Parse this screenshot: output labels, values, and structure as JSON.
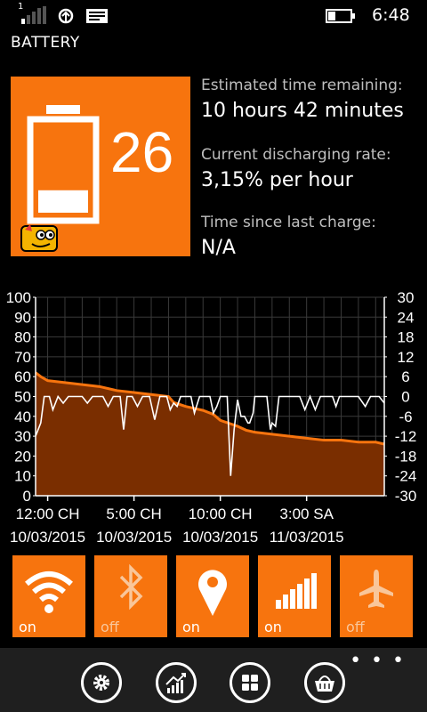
{
  "status_bar": {
    "time": "6:48",
    "sim": "1",
    "icons": [
      "signal-icon",
      "sync-icon",
      "message-icon",
      "battery-status-icon"
    ]
  },
  "app": {
    "title": "BATTERY"
  },
  "battery": {
    "percent": "26",
    "level": 0.26,
    "accent": "#f7740e",
    "info": [
      {
        "label": "Estimated time remaining:",
        "value": "10 hours 42 minutes"
      },
      {
        "label": "Current discharging rate:",
        "value": "3,15% per hour"
      },
      {
        "label": "Time since last charge:",
        "value": "N/A"
      }
    ]
  },
  "chart_data": {
    "type": "area",
    "left_ticks": [
      100,
      90,
      80,
      70,
      60,
      50,
      40,
      30,
      20,
      10,
      0
    ],
    "right_ticks": [
      30,
      24,
      18,
      12,
      6,
      0,
      -6,
      -12,
      -18,
      -24,
      -30
    ],
    "ylim_left": [
      0,
      100
    ],
    "ylim_right": [
      -30,
      30
    ],
    "x_ticks": [
      {
        "x": 0,
        "time": "12:00 CH",
        "date": "10/03/2015"
      },
      {
        "x": 5,
        "time": "5:00 CH",
        "date": "10/03/2015"
      },
      {
        "x": 10,
        "time": "10:00 CH",
        "date": "10/03/2015"
      },
      {
        "x": 15,
        "time": "3:00 SA",
        "date": "11/03/2015"
      }
    ],
    "xlim": [
      -0.7,
      19.5
    ],
    "grid": true,
    "series": [
      {
        "kind": "area",
        "axis": "left",
        "color": "#f7740e",
        "points": [
          [
            -0.7,
            62
          ],
          [
            -0.4,
            60
          ],
          [
            0,
            58
          ],
          [
            1,
            57
          ],
          [
            2,
            56
          ],
          [
            3,
            55
          ],
          [
            4,
            53
          ],
          [
            5,
            52
          ],
          [
            6,
            51
          ],
          [
            7,
            50
          ],
          [
            7.3,
            47
          ],
          [
            8,
            45
          ],
          [
            8.5,
            44
          ],
          [
            9,
            43
          ],
          [
            9.6,
            41
          ],
          [
            10,
            38
          ],
          [
            11,
            35
          ],
          [
            11.5,
            33
          ],
          [
            12,
            32
          ],
          [
            13,
            31
          ],
          [
            14,
            30
          ],
          [
            15,
            29
          ],
          [
            16,
            28
          ],
          [
            17,
            28
          ],
          [
            18,
            27
          ],
          [
            19,
            27
          ],
          [
            19.5,
            26
          ]
        ]
      },
      {
        "kind": "line",
        "axis": "right",
        "color": "#ffffff",
        "points": [
          [
            -0.7,
            -12
          ],
          [
            -0.4,
            -8
          ],
          [
            -0.2,
            0
          ],
          [
            0.1,
            0
          ],
          [
            0.3,
            -4
          ],
          [
            0.6,
            0
          ],
          [
            0.9,
            -2
          ],
          [
            1.2,
            0
          ],
          [
            2,
            0
          ],
          [
            2.3,
            -2
          ],
          [
            2.6,
            0
          ],
          [
            3.2,
            0
          ],
          [
            3.5,
            -3
          ],
          [
            3.8,
            0
          ],
          [
            4.2,
            0
          ],
          [
            4.4,
            -10
          ],
          [
            4.6,
            0
          ],
          [
            4.9,
            0
          ],
          [
            5.2,
            -3
          ],
          [
            5.5,
            0
          ],
          [
            5.9,
            0
          ],
          [
            6.2,
            -7
          ],
          [
            6.5,
            0
          ],
          [
            6.9,
            0
          ],
          [
            7.1,
            -4
          ],
          [
            7.3,
            -2
          ],
          [
            7.5,
            -3
          ],
          [
            7.7,
            0
          ],
          [
            8.3,
            0
          ],
          [
            8.5,
            -5
          ],
          [
            8.8,
            0
          ],
          [
            9.4,
            0
          ],
          [
            9.6,
            -5
          ],
          [
            9.8,
            -3
          ],
          [
            10,
            0
          ],
          [
            10.4,
            0
          ],
          [
            10.6,
            -24
          ],
          [
            10.8,
            -10
          ],
          [
            11,
            -1
          ],
          [
            11.2,
            -6
          ],
          [
            11.4,
            -6
          ],
          [
            11.6,
            -8
          ],
          [
            11.7,
            -8
          ],
          [
            11.9,
            -5
          ],
          [
            12,
            0
          ],
          [
            12.7,
            0
          ],
          [
            12.9,
            -10
          ],
          [
            13,
            -8
          ],
          [
            13.2,
            -9
          ],
          [
            13.4,
            0
          ],
          [
            14,
            0
          ],
          [
            14.6,
            0
          ],
          [
            14.9,
            -4
          ],
          [
            15.2,
            0
          ],
          [
            15.5,
            -4
          ],
          [
            15.8,
            0
          ],
          [
            16.5,
            0
          ],
          [
            16.7,
            -3
          ],
          [
            16.9,
            0
          ],
          [
            17.5,
            0
          ],
          [
            18,
            0
          ],
          [
            18.4,
            -3
          ],
          [
            18.7,
            0
          ],
          [
            19.2,
            0
          ],
          [
            19.5,
            -2
          ]
        ]
      }
    ]
  },
  "toggles": [
    {
      "id": "wifi",
      "icon": "wifi-icon",
      "state": "on"
    },
    {
      "id": "bluetooth",
      "icon": "bluetooth-icon",
      "state": "off"
    },
    {
      "id": "location",
      "icon": "location-pin-icon",
      "state": "on"
    },
    {
      "id": "cellular",
      "icon": "cellular-signal-icon",
      "state": "on"
    },
    {
      "id": "airplane",
      "icon": "airplane-icon",
      "state": "off"
    }
  ],
  "app_bar": {
    "more": "• • •",
    "buttons": [
      "settings-icon",
      "chart-icon",
      "grid-icon",
      "basket-icon"
    ]
  }
}
